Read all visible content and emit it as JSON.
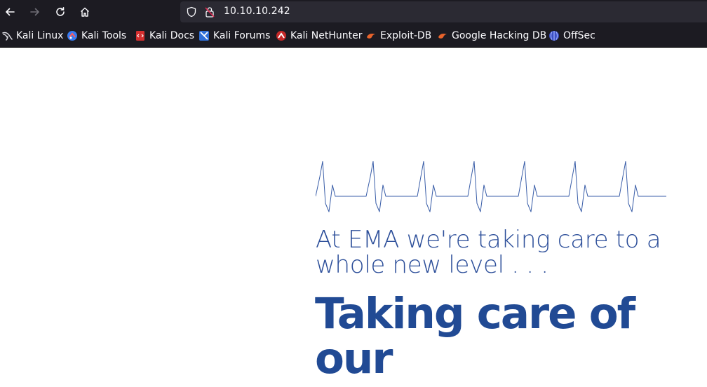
{
  "browser": {
    "url": "10.10.10.242",
    "nav": {
      "back_icon": "arrow-left-icon",
      "forward_icon": "arrow-right-icon",
      "reload_icon": "reload-icon",
      "home_icon": "home-icon"
    },
    "bookmarks": [
      {
        "label": "Kali Linux",
        "icon": "kali-dragon-icon"
      },
      {
        "label": "Kali Tools",
        "icon": "kali-tools-icon"
      },
      {
        "label": "Kali Docs",
        "icon": "kali-docs-icon"
      },
      {
        "label": "Kali Forums",
        "icon": "kali-forums-icon"
      },
      {
        "label": "Kali NetHunter",
        "icon": "nethunter-icon"
      },
      {
        "label": "Exploit-DB",
        "icon": "exploit-db-icon"
      },
      {
        "label": "Google Hacking DB",
        "icon": "ghdb-icon"
      },
      {
        "label": "OffSec",
        "icon": "offsec-icon"
      }
    ]
  },
  "page": {
    "tagline": "At EMA we're taking care to a whole new level . . .",
    "headline": "Taking care of our",
    "colors": {
      "tagline": "#2d4f9a",
      "headline": "#214a94",
      "heartbeat_line": "#3a5ea8"
    }
  }
}
